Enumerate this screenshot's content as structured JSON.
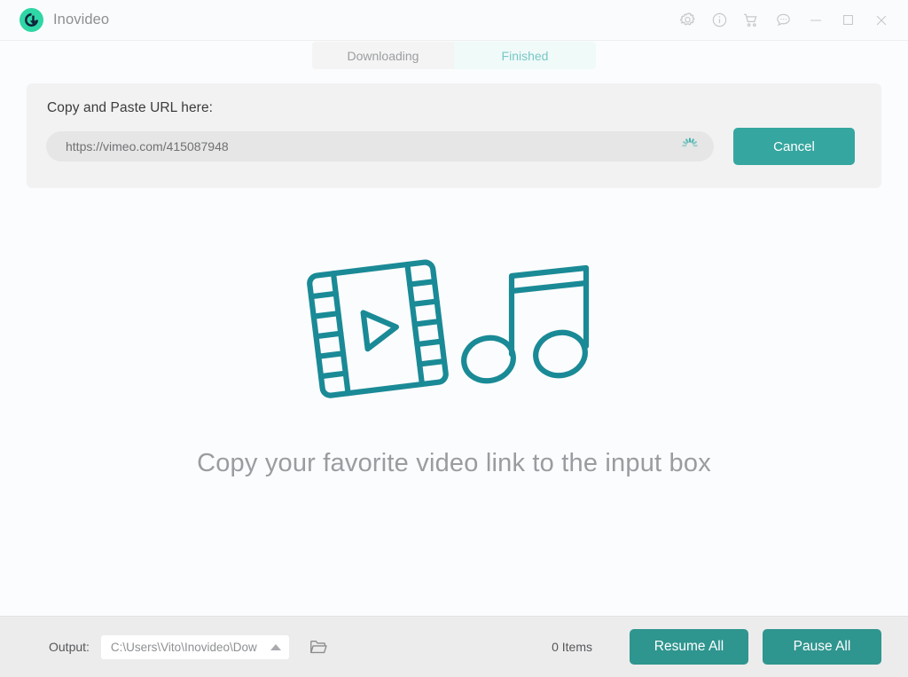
{
  "window": {
    "title": "Inovideo",
    "logo_icon": "download-circle-logo",
    "controls": [
      {
        "name": "settings-icon",
        "label": "Settings"
      },
      {
        "name": "info-icon",
        "label": "Info"
      },
      {
        "name": "cart-icon",
        "label": "Store"
      },
      {
        "name": "feedback-icon",
        "label": "Feedback"
      },
      {
        "name": "minimize-icon",
        "label": "Minimize"
      },
      {
        "name": "maximize-icon",
        "label": "Maximize"
      },
      {
        "name": "close-icon",
        "label": "Close"
      }
    ]
  },
  "tabs": [
    {
      "label": "Downloading",
      "active": false
    },
    {
      "label": "Finished",
      "active": true
    }
  ],
  "url_panel": {
    "label": "Copy and Paste URL here:",
    "input_value": "https://vimeo.com/415087948",
    "input_placeholder": "Copy and Paste URL here",
    "loading": true,
    "spinner_icon": "loading-spinner-icon",
    "cancel_label": "Cancel"
  },
  "empty_state": {
    "illustration": "film-strip-and-music-note-icon",
    "message": "Copy your favorite video link to the input box"
  },
  "bottom_bar": {
    "output_label": "Output:",
    "output_path": "C:\\Users\\Vito\\Inovideo\\Dow",
    "dropdown_icon": "caret-up-icon",
    "folder_icon": "folder-open-icon",
    "items_count": "0 Items",
    "resume_all_label": "Resume All",
    "pause_all_label": "Pause All"
  },
  "colors": {
    "accent_teal": "#36a6a0",
    "accent_teal_dark": "#2f958f",
    "logo_green": "#2fd6a6",
    "tab_active_text": "#79c7c5",
    "tab_active_bg": "#effaf9",
    "panel_bg": "#f2f2f2",
    "page_bg": "#fbfcfd",
    "bottom_bar_bg": "#ececec",
    "illustration": "#1a8a96",
    "muted_text": "#9a9ca0"
  }
}
